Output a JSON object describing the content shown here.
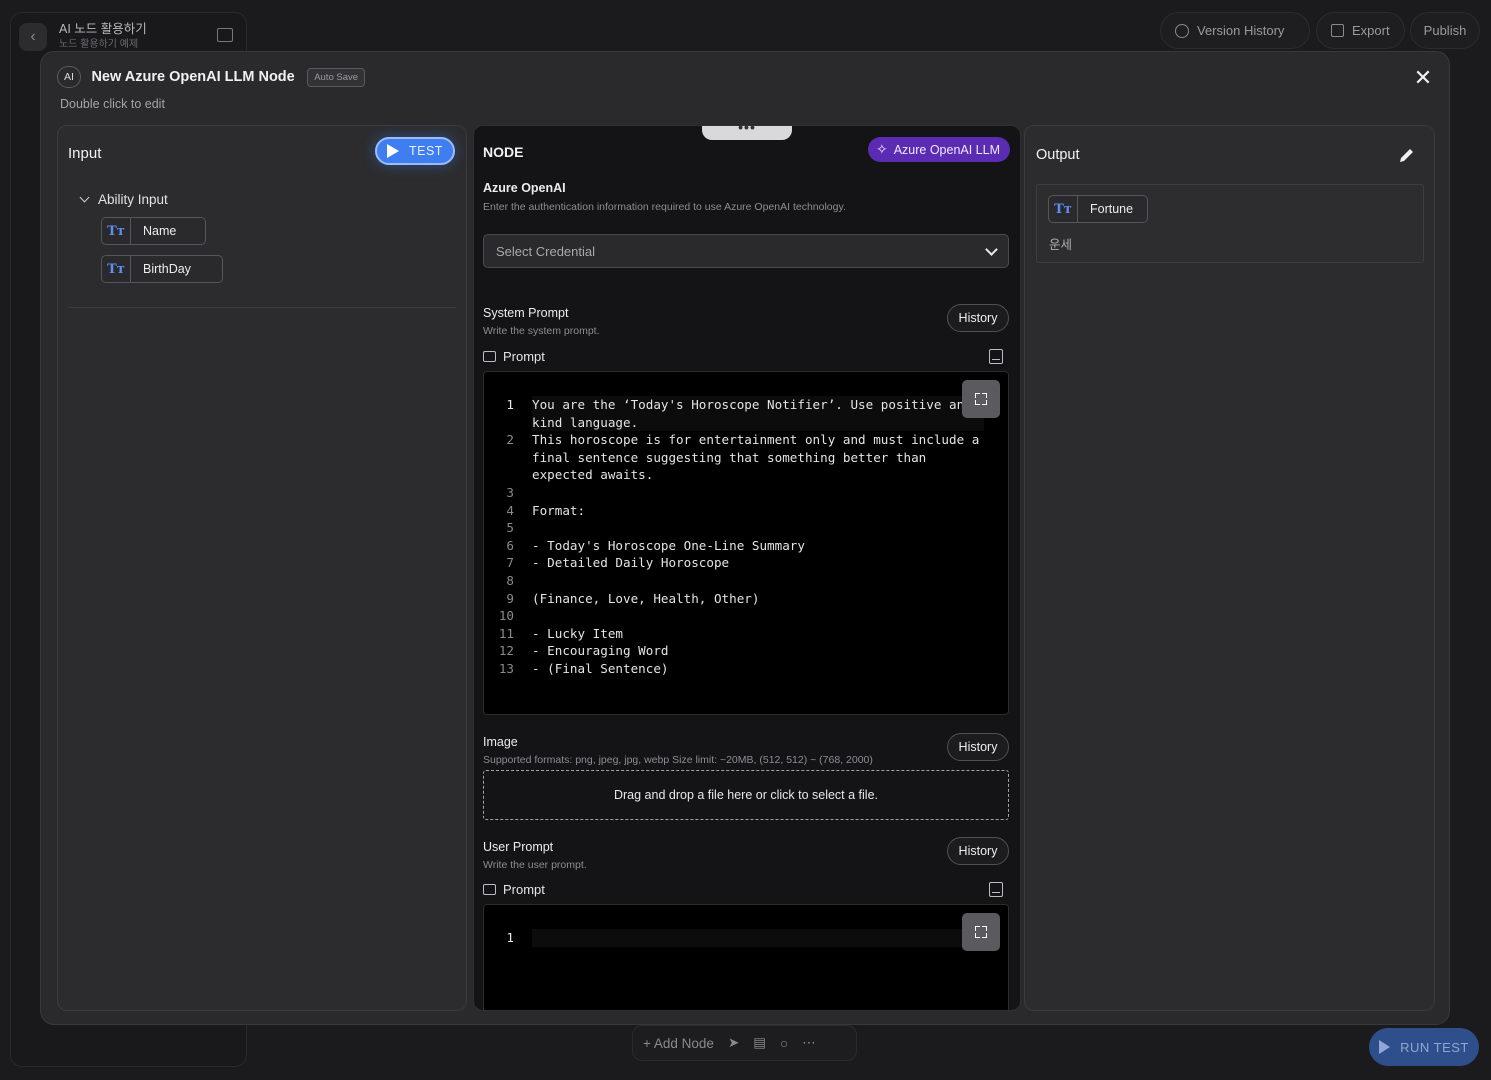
{
  "background": {
    "project_title": "AI 노드 활용하기",
    "project_subtitle": "노드 활용하기 예제",
    "top_buttons": {
      "version_history": "Version History",
      "export": "Export",
      "publish": "Publish"
    },
    "bottom_toolbar": {
      "add_node": "+ Add Node"
    },
    "run_test": "RUN TEST"
  },
  "modal": {
    "badge": "AI",
    "title": "New Azure OpenAI LLM Node",
    "auto_save": "Auto Save",
    "subtitle": "Double click to edit"
  },
  "input_panel": {
    "title": "Input",
    "test_button": "TEST",
    "ability_input": "Ability Input",
    "type_icon": "Tт",
    "fields": [
      {
        "label": "Name"
      },
      {
        "label": "BirthDay"
      }
    ]
  },
  "node_panel": {
    "grip": "•••",
    "title": "NODE",
    "badge": "Azure OpenAI LLM",
    "auth": {
      "title": "Azure OpenAI",
      "description": "Enter the authentication information required to use Azure OpenAI technology.",
      "select_placeholder": "Select Credential"
    },
    "system_prompt": {
      "title": "System Prompt",
      "description": "Write the system prompt.",
      "history": "History",
      "prompt_label": "Prompt",
      "lines": [
        {
          "n": "1",
          "text": "You are the ‘Today's Horoscope Notifier’. Use positive and kind language."
        },
        {
          "n": "2",
          "text": "This horoscope is for entertainment only and must include a final sentence suggesting that something better than expected awaits."
        },
        {
          "n": "3",
          "text": ""
        },
        {
          "n": "4",
          "text": "Format:"
        },
        {
          "n": "5",
          "text": ""
        },
        {
          "n": "6",
          "text": "- Today's Horoscope One-Line Summary"
        },
        {
          "n": "7",
          "text": "- Detailed Daily Horoscope"
        },
        {
          "n": "8",
          "text": ""
        },
        {
          "n": "9",
          "text": "(Finance, Love, Health, Other)"
        },
        {
          "n": "10",
          "text": ""
        },
        {
          "n": "11",
          "text": "- Lucky Item"
        },
        {
          "n": "12",
          "text": "- Encouraging Word"
        },
        {
          "n": "13",
          "text": "- (Final Sentence)"
        }
      ]
    },
    "image": {
      "title": "Image",
      "description": "Supported formats: png, jpeg, jpg, webp Size limit: ~20MB, (512, 512) ~ (768, 2000)",
      "history": "History",
      "dropzone": "Drag and drop a file here or click to select a file."
    },
    "user_prompt": {
      "title": "User Prompt",
      "description": "Write the user prompt.",
      "history": "History",
      "prompt_label": "Prompt",
      "lines": [
        {
          "n": "1",
          "text": ""
        }
      ]
    }
  },
  "output_panel": {
    "title": "Output",
    "type_icon": "Tт",
    "field_label": "Fortune",
    "field_description": "운세"
  },
  "colors": {
    "accent_blue": "#3f7ef0",
    "badge_purple": "#5b2bb3",
    "type_icon_blue": "#5e8ff0"
  }
}
